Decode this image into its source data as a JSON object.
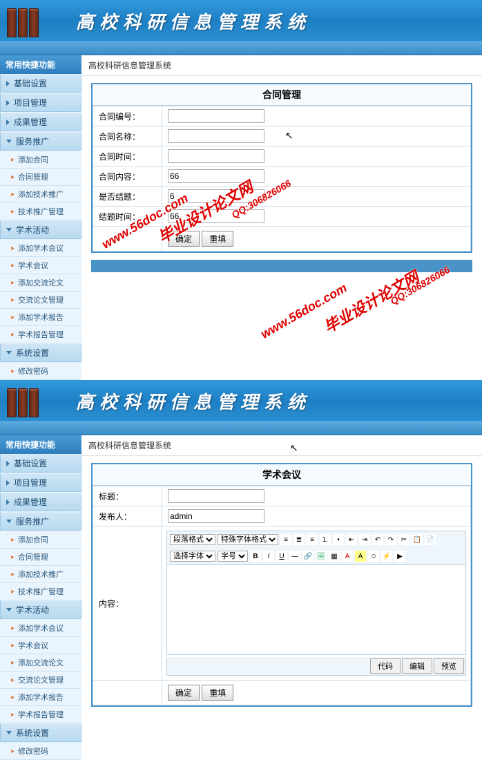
{
  "header": {
    "title": "高校科研信息管理系统"
  },
  "sidebar": {
    "header": "常用快捷功能",
    "groups": {
      "basic": "基础设置",
      "project": "项目管理",
      "result": "成果管理",
      "service": "服务推广",
      "academic": "学术活动",
      "system": "系统设置"
    },
    "serviceItems": {
      "addContract": "添加合同",
      "contractMgmt": "合同管理",
      "addTech": "添加技术推广",
      "techMgmt": "技术推广管理"
    },
    "academicItems": {
      "addMeeting": "添加学术会议",
      "meeting": "学术会议",
      "addPaper": "添加交流论文",
      "paperMgmt": "交流论文管理",
      "addReport": "添加学术报告",
      "reportMgmt": "学术报告管理"
    },
    "systemItems": {
      "changePwd": "修改密码"
    }
  },
  "breadcrumb": "高校科研信息管理系统",
  "panel1": {
    "title": "合同管理",
    "fields": {
      "contractNo": {
        "label": "合同编号：",
        "value": ""
      },
      "contractName": {
        "label": "合同名称：",
        "value": ""
      },
      "contractTime": {
        "label": "合同时间：",
        "value": ""
      },
      "contractContent": {
        "label": "合同内容：",
        "value": "66"
      },
      "isFinished": {
        "label": "是否结题：",
        "value": "6"
      },
      "finishTime": {
        "label": "结题时间：",
        "value": "66"
      }
    },
    "buttons": {
      "submit": "确定",
      "reset": "重填"
    }
  },
  "panel2": {
    "title": "学术会议",
    "fields": {
      "subject": {
        "label": "标题：",
        "value": ""
      },
      "publisher": {
        "label": "发布人：",
        "value": "admin"
      },
      "content": {
        "label": "内容：",
        "value": ""
      }
    },
    "editor": {
      "paraFormat": "段落格式",
      "fontFormat": "特殊字体格式",
      "fontSelect": "选择字体",
      "fontSize": "字号",
      "tabs": {
        "code": "代码",
        "edit": "编辑",
        "preview": "预览"
      }
    },
    "buttons": {
      "submit": "确定",
      "reset": "重填"
    }
  },
  "watermark": {
    "site": "www.56doc.com",
    "brand": "毕业设计论文网",
    "qq": "QQ:306826066"
  }
}
